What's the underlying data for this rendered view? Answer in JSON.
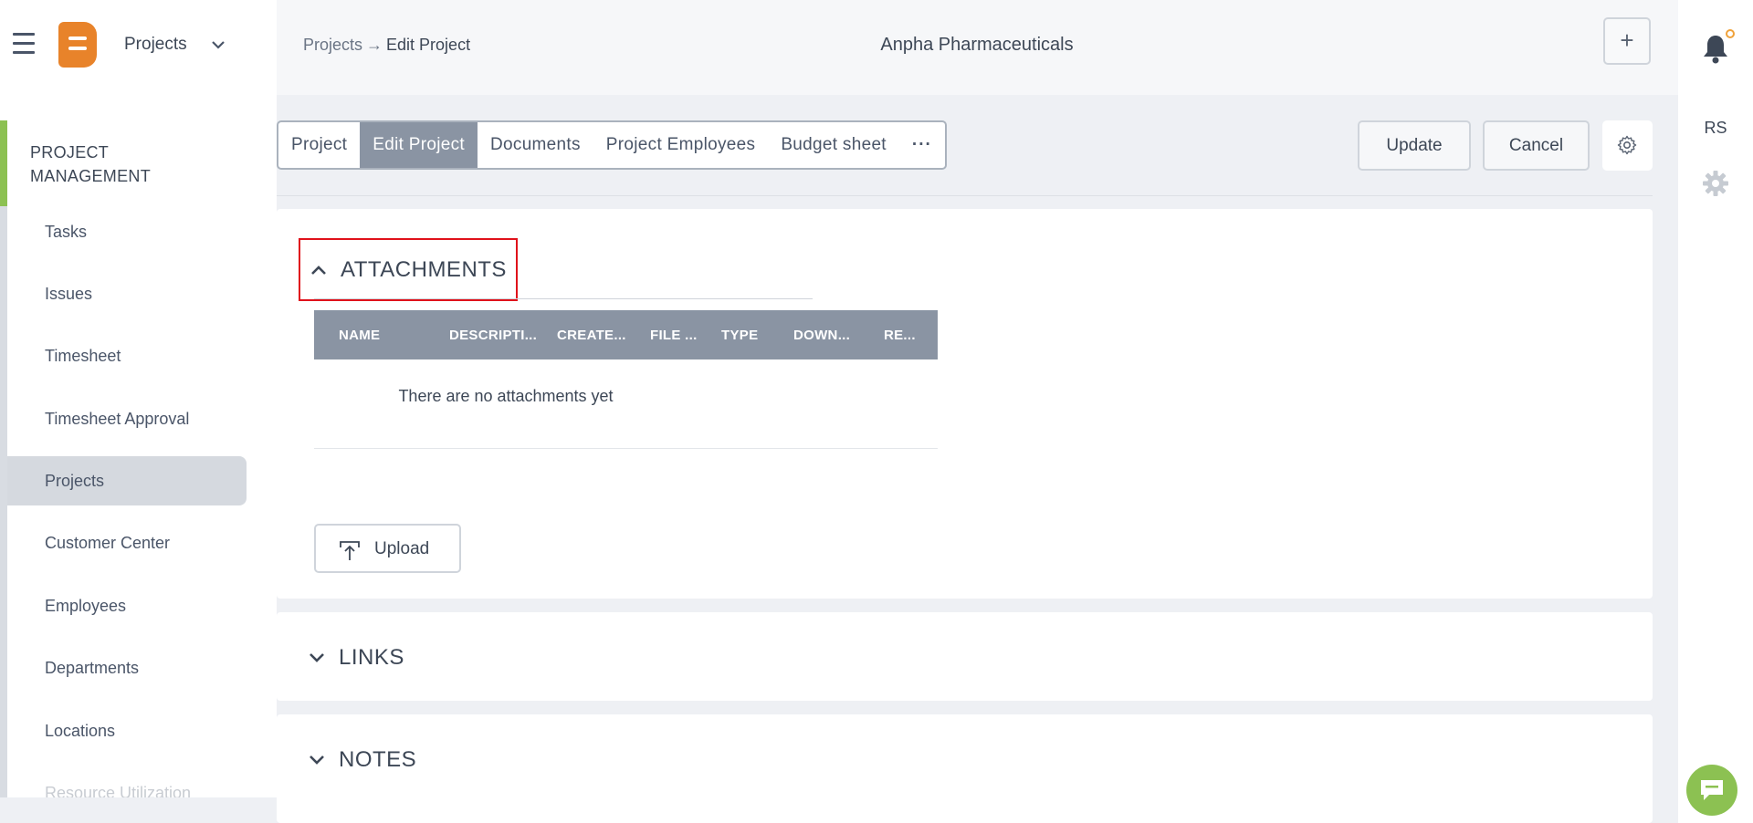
{
  "header": {
    "module_title": "Projects",
    "breadcrumb_root": "Projects",
    "breadcrumb_arrow": "→",
    "breadcrumb_current": "Edit Project",
    "company_name": "Anpha Pharmaceuticals",
    "plus_label": "+"
  },
  "right_rail": {
    "avatar_initials": "RS"
  },
  "sidebar": {
    "section_title": "PROJECT MANAGEMENT",
    "items": [
      {
        "label": "Tasks"
      },
      {
        "label": "Issues"
      },
      {
        "label": "Timesheet"
      },
      {
        "label": "Timesheet Approval"
      },
      {
        "label": "Projects",
        "active": true
      },
      {
        "label": "Customer Center"
      },
      {
        "label": "Employees"
      },
      {
        "label": "Departments"
      },
      {
        "label": "Locations"
      },
      {
        "label": "Resource Utilization"
      }
    ]
  },
  "tabs": [
    {
      "label": "Project"
    },
    {
      "label": "Edit Project",
      "active": true
    },
    {
      "label": "Documents"
    },
    {
      "label": "Project Employees"
    },
    {
      "label": "Budget sheet"
    },
    {
      "label": "···"
    }
  ],
  "actions": {
    "update_label": "Update",
    "cancel_label": "Cancel"
  },
  "attachments": {
    "title": "ATTACHMENTS",
    "columns": [
      "NAME",
      "DESCRIPTI...",
      "CREATE...",
      "FILE ...",
      "TYPE",
      "DOWN...",
      "RE..."
    ],
    "empty_message": "There are no attachments yet",
    "upload_label": "Upload"
  },
  "links": {
    "title": "LINKS"
  },
  "notes": {
    "title": "NOTES"
  },
  "colors": {
    "accent_green": "#8cc152",
    "logo_orange": "#e8832a",
    "highlight_red": "#e0121b",
    "table_header": "#8a94a3"
  }
}
